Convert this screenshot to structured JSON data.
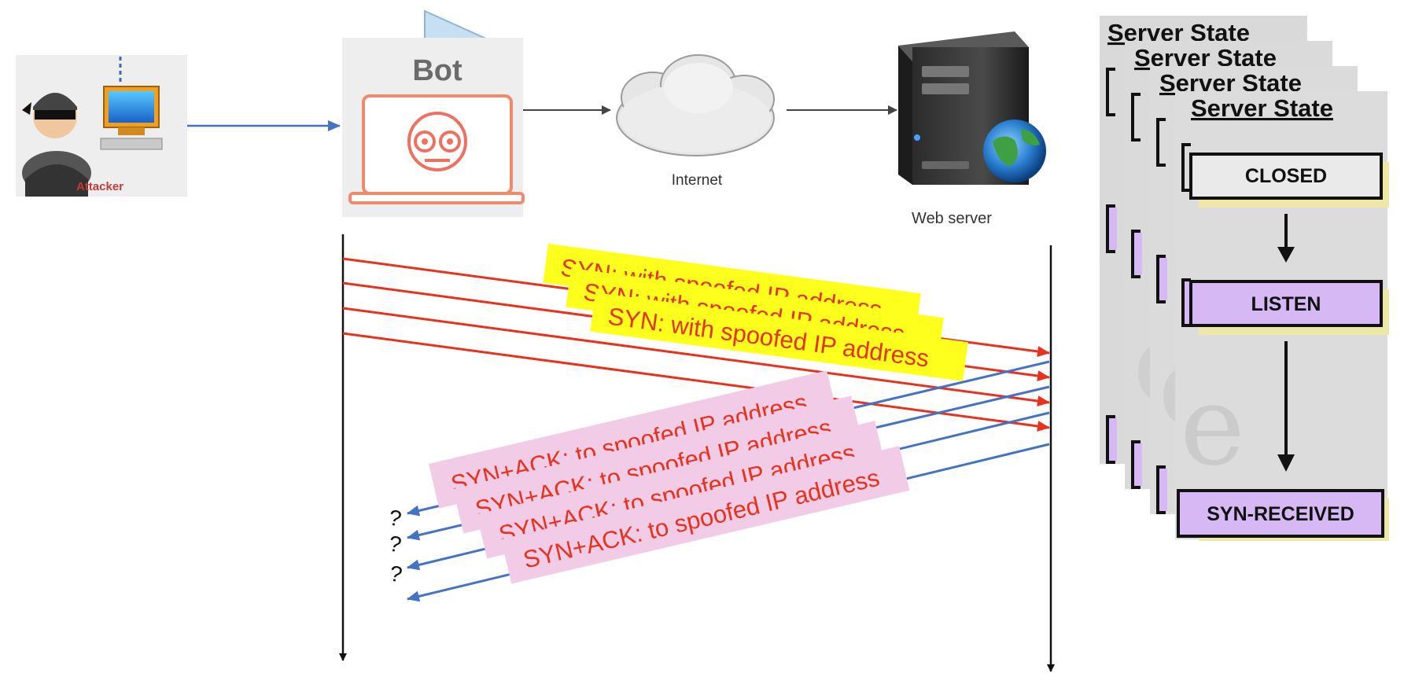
{
  "attacker": {
    "label": "Attacker"
  },
  "bot": {
    "label": "Bot"
  },
  "internet": {
    "label": "Internet"
  },
  "webserver": {
    "label": "Web server"
  },
  "syn_label": "SYN: with spoofed IP address",
  "synack_label": "SYN+ACK: to spoofed IP address",
  "unknown_mark": "?",
  "server_state": {
    "title": "Server State",
    "states": [
      "CLOSED",
      "LISTEN",
      "SYN-RECEIVED"
    ]
  },
  "colors": {
    "syn_arrow": "#e8321e",
    "synack_arrow": "#4472c4",
    "syn_box": "#ffff1e",
    "synack_box": "#f2cce6",
    "syn_text": "#e8321e",
    "state_box_listen": "#d6b8f5",
    "state_box_closed": "#eaeaea",
    "state_panel": "#d9d9d9",
    "state_shadow": "#efe7a8"
  }
}
